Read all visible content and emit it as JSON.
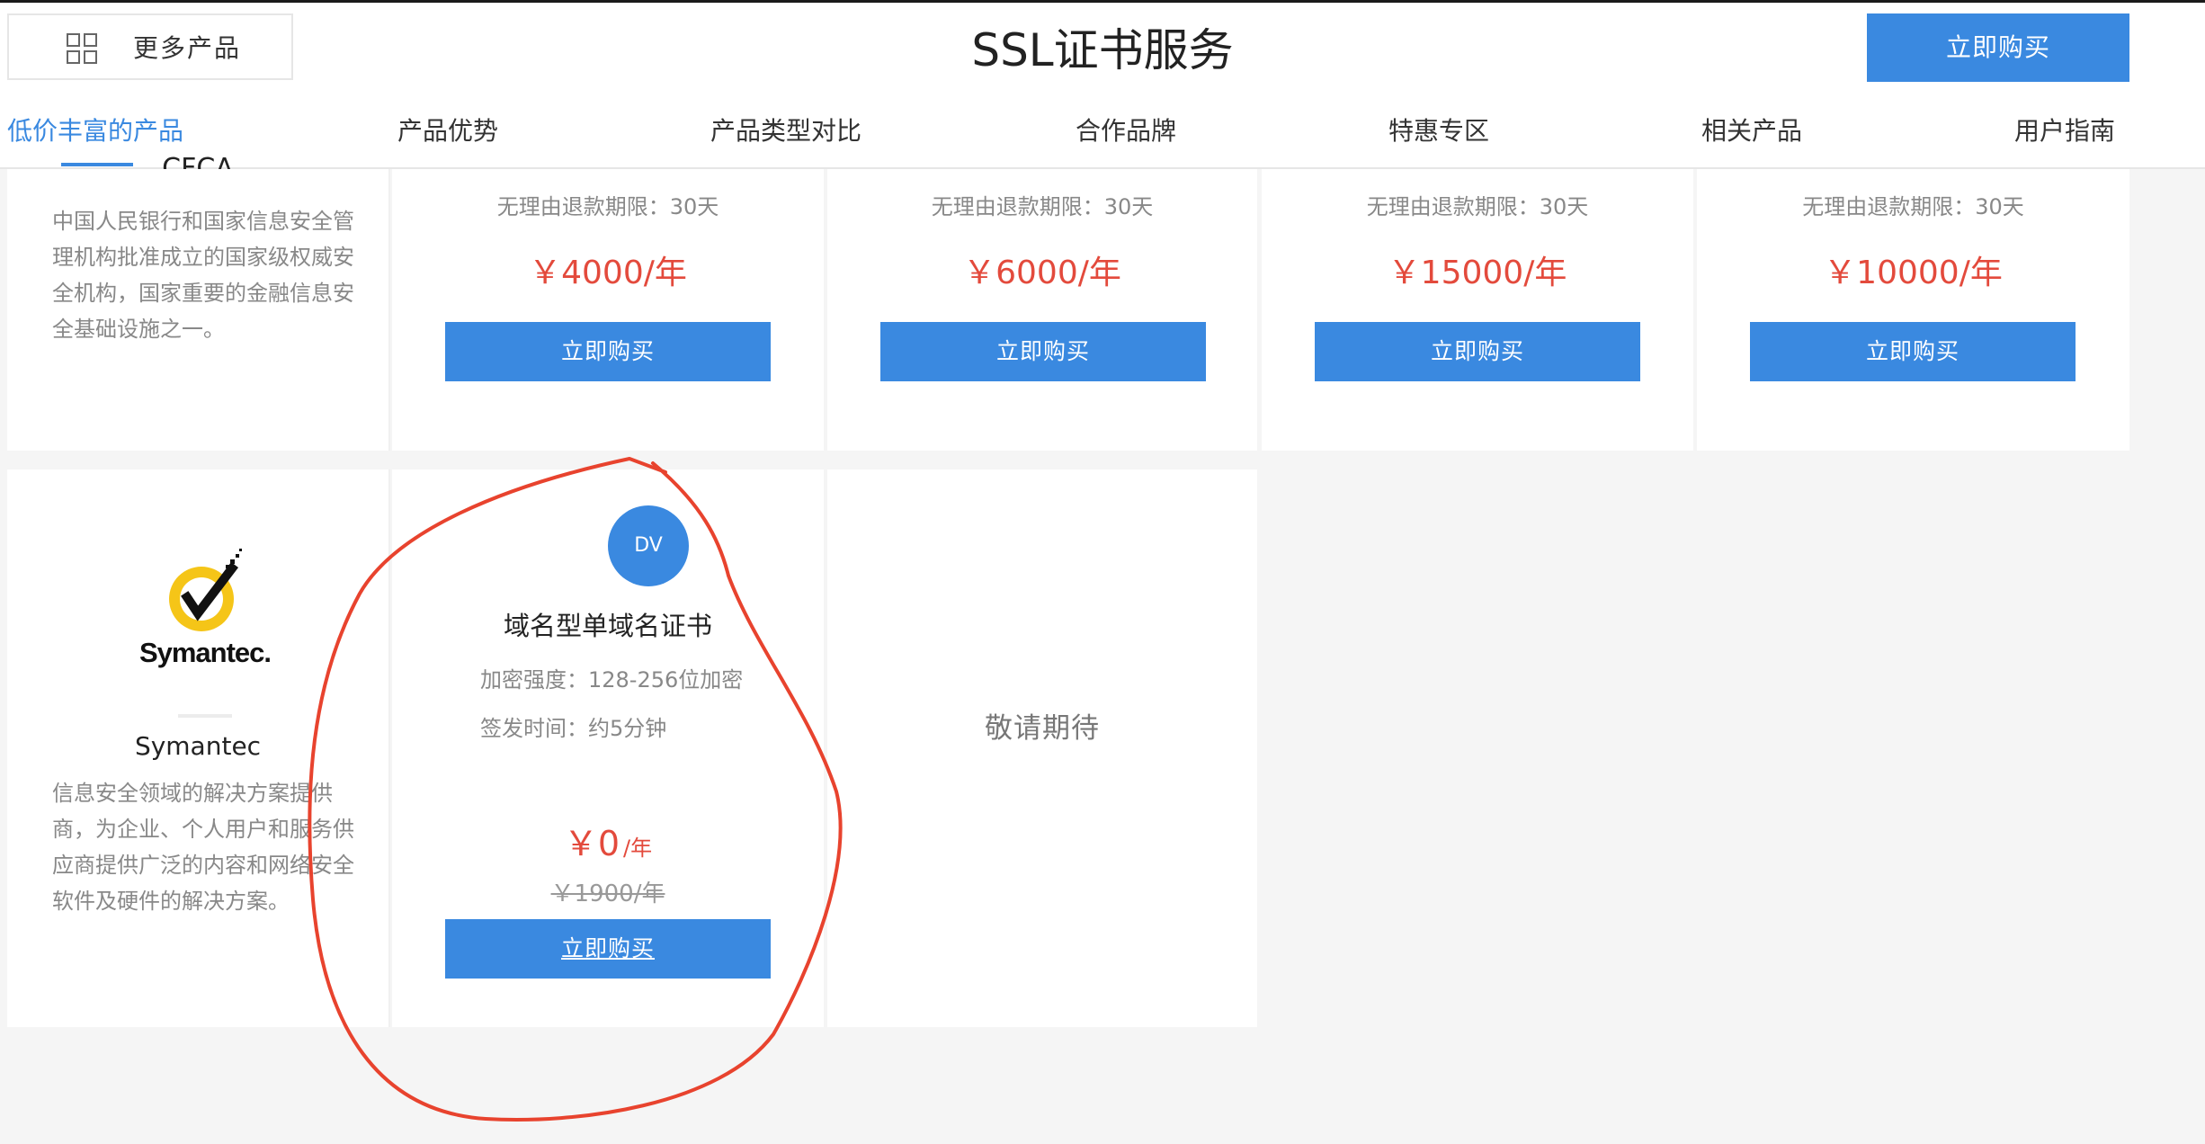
{
  "header": {
    "more_products_label": "更多产品",
    "title": "SSL证书服务",
    "buy_label": "立即购买"
  },
  "nav": {
    "items": [
      {
        "label": "低价丰富的产品",
        "active": true
      },
      {
        "label": "产品优势"
      },
      {
        "label": "产品类型对比"
      },
      {
        "label": "合作品牌"
      },
      {
        "label": "特惠专区"
      },
      {
        "label": "相关产品"
      },
      {
        "label": "用户指南"
      }
    ]
  },
  "row1": {
    "brand": {
      "name_partial": "CFCA",
      "desc": "中国人民银行和国家信息安全管理机构批准成立的国家级权威安全机构，国家重要的金融信息安全基础设施之一。"
    },
    "products": [
      {
        "refund": "无理由退款期限：30天",
        "price": "￥4000/年",
        "buy_label": "立即购买"
      },
      {
        "refund": "无理由退款期限：30天",
        "price": "￥6000/年",
        "buy_label": "立即购买"
      },
      {
        "refund": "无理由退款期限：30天",
        "price": "￥15000/年",
        "buy_label": "立即购买"
      },
      {
        "refund": "无理由退款期限：30天",
        "price": "￥10000/年",
        "buy_label": "立即购买"
      }
    ]
  },
  "row2": {
    "brand": {
      "logo_text": "Symantec.",
      "name": "Symantec",
      "desc": "信息安全领域的解决方案提供商，为企业、个人用户和服务供应商提供广泛的内容和网络安全软件及硬件的解决方案。"
    },
    "product": {
      "badge": "DV",
      "title": "域名型单域名证书",
      "spec_encryption": "加密强度：128-256位加密",
      "spec_issue": "签发时间：约5分钟",
      "sale_price": "￥0",
      "sale_unit": "/年",
      "original_price": "￥1900/年",
      "buy_label": "立即购买"
    },
    "placeholder": "敬请期待"
  },
  "colors": {
    "accent": "#3a89e0",
    "price": "#e34a3c",
    "annotation": "#e8432e"
  }
}
